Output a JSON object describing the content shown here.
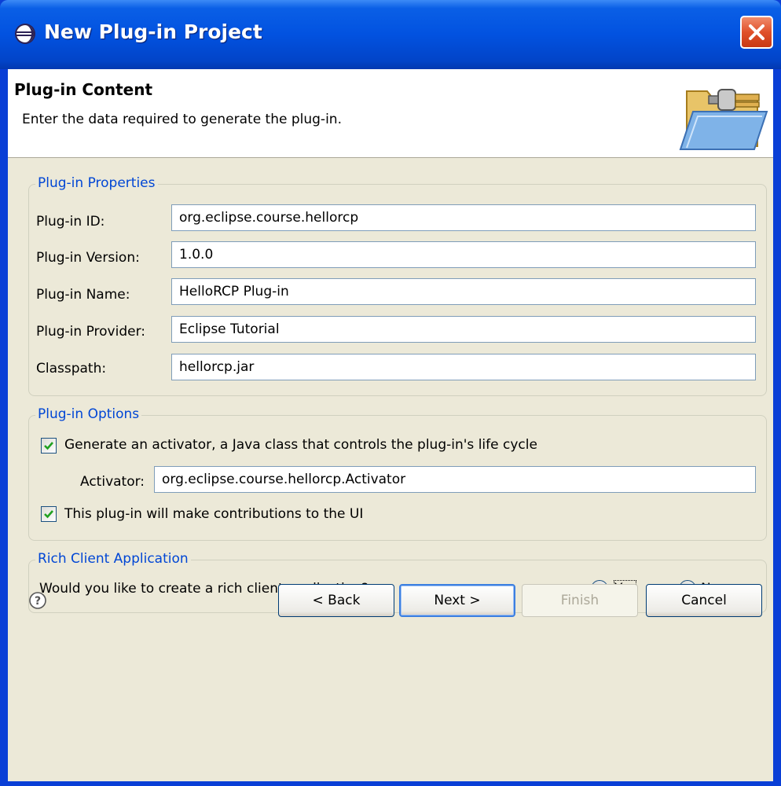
{
  "window": {
    "title": "New Plug-in Project"
  },
  "header": {
    "title": "Plug-in Content",
    "description": "Enter the data required to generate the plug-in."
  },
  "properties": {
    "group_title": "Plug-in Properties",
    "fields": [
      {
        "label": "Plug-in ID:",
        "value": "org.eclipse.course.hellorcp"
      },
      {
        "label": "Plug-in Version:",
        "value": "1.0.0"
      },
      {
        "label": "Plug-in Name:",
        "value": "HelloRCP Plug-in"
      },
      {
        "label": "Plug-in Provider:",
        "value": "Eclipse Tutorial"
      },
      {
        "label": "Classpath:",
        "value": "hellorcp.jar"
      }
    ]
  },
  "options": {
    "group_title": "Plug-in Options",
    "generate_activator": {
      "label": "Generate an activator, a Java class that controls the plug-in's life cycle",
      "checked": true
    },
    "activator": {
      "label": "Activator:",
      "value": "org.eclipse.course.hellorcp.Activator"
    },
    "ui_contributions": {
      "label": "This plug-in will make contributions to the UI",
      "checked": true
    }
  },
  "rcp": {
    "group_title": "Rich Client Application",
    "question": "Would you like to create a rich client application?",
    "yes_label": "Yes",
    "no_label": "No",
    "selected": "Yes"
  },
  "buttons": {
    "back": "< Back",
    "next": "Next >",
    "finish": "Finish",
    "cancel": "Cancel"
  },
  "colors": {
    "title_bar": "#0252e0",
    "group_title": "#0046d5",
    "dialog_bg": "#ece9d8"
  }
}
